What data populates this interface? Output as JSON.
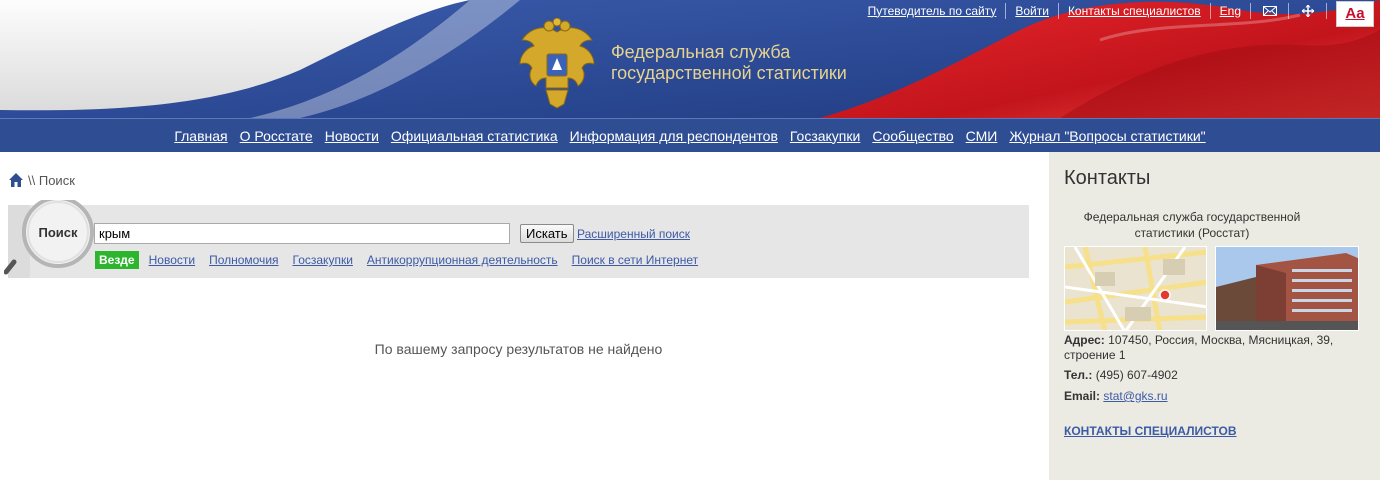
{
  "header": {
    "org_line1": "Федеральная служба",
    "org_line2": "государственной статистики",
    "top_links": [
      "Путеводитель по сайту",
      "Войти",
      "Контакты специалистов",
      "Eng"
    ],
    "font_button": "Aa",
    "icons": [
      "mail-icon",
      "sitemap-icon"
    ]
  },
  "nav": {
    "items": [
      "Главная",
      "О Росстате",
      "Новости",
      "Официальная статистика",
      "Информация для респондентов",
      "Госзакупки",
      "Сообщество",
      "СМИ",
      "Журнал \"Вопросы статистики\""
    ]
  },
  "breadcrumb": {
    "separator": "\\\\",
    "current": "Поиск"
  },
  "search": {
    "lens_label": "Поиск",
    "query": "крым",
    "button": "Искать",
    "advanced": "Расширенный поиск",
    "scopes": [
      "Везде",
      "Новости",
      "Полномочия",
      "Госзакупки",
      "Антикоррупционная деятельность",
      "Поиск в сети Интернет"
    ],
    "active_scope": "Везде"
  },
  "results": {
    "empty_message": "По вашему запросу результатов не найдено"
  },
  "sidebar": {
    "title": "Контакты",
    "org_full": "Федеральная служба государственной статистики (Росстат)",
    "address_label": "Адрес:",
    "address": "107450, Россия, Москва, Мясницкая, 39, строение 1",
    "phone_label": "Тел.:",
    "phone": "(495) 607-4902",
    "email_label": "Email:",
    "email": "stat@gks.ru",
    "specialists_link": "КОНТАКТЫ СПЕЦИАЛИСТОВ"
  },
  "colors": {
    "nav_blue": "#2e4d92",
    "flag_red": "#d01c22",
    "active_scope": "#2db52d",
    "link": "#3c5aa6",
    "sidebar_bg": "#ecebe3",
    "title_gold": "#e6d38f"
  }
}
